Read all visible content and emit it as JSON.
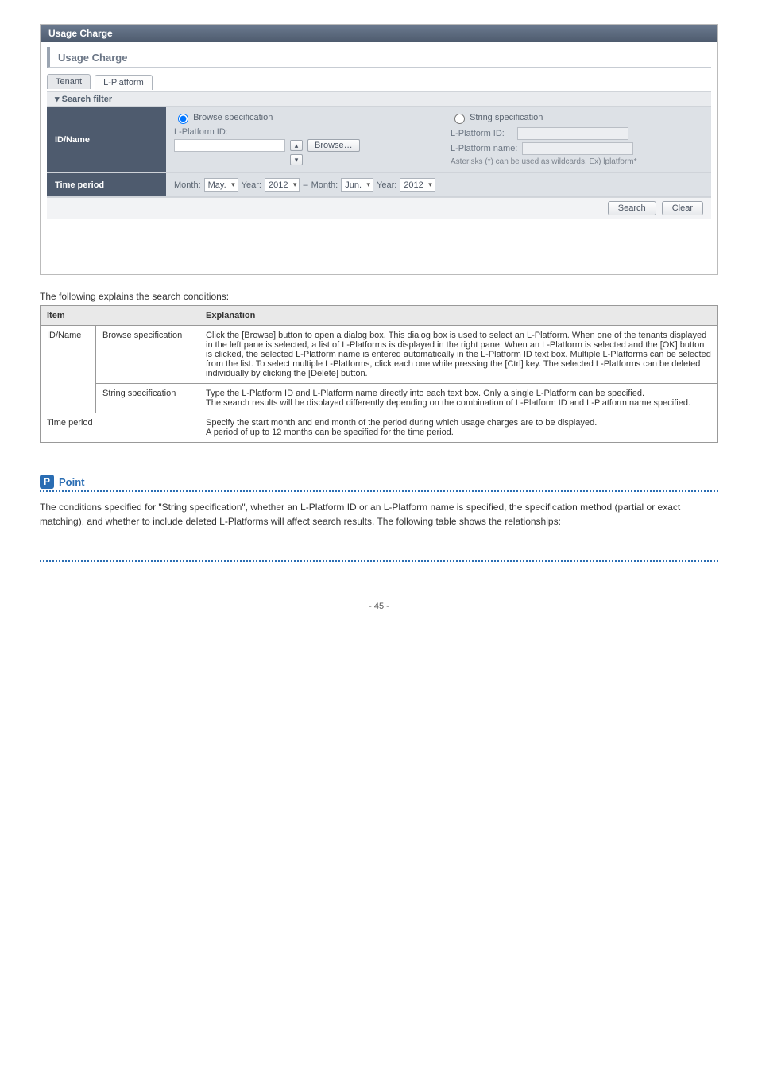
{
  "panel": {
    "title": "Usage Charge",
    "subtitle": "Usage Charge",
    "tabs": {
      "tenant": "Tenant",
      "lplatform": "L-Platform"
    },
    "filter_header": "▾ Search filter",
    "idname": {
      "label": "ID/Name",
      "browse": {
        "title": "Browse specification",
        "lplatform_id_label": "L-Platform ID:",
        "browse_btn": "Browse…"
      },
      "string": {
        "title": "String specification",
        "lplatform_id_label": "L-Platform ID:",
        "lplatform_name_label": "L-Platform name:",
        "hint": "Asterisks (*) can be used as wildcards. Ex) lplatform*"
      }
    },
    "timeperiod": {
      "label": "Time period",
      "month_label": "Month:",
      "year_label": "Year:",
      "from_month": "May.",
      "from_year": "2012",
      "dash": "–",
      "to_month": "Jun.",
      "to_year": "2012"
    },
    "buttons": {
      "search": "Search",
      "clear": "Clear"
    }
  },
  "desc_text": "The following explains the search conditions:",
  "table": {
    "headers": {
      "item": "Item",
      "explanation": "Explanation"
    },
    "rows": [
      {
        "item_main": "ID/Name",
        "item_sub": "Browse specification",
        "explanation": "Click the [Browse] button to open a dialog box. This dialog box is used to select an L-Platform. When one of the tenants displayed in the left pane is selected, a list of L-Platforms is displayed in the right pane. When an L-Platform is selected and the [OK] button is clicked, the selected L-Platform name is entered automatically in the L-Platform ID text box. Multiple L-Platforms can be selected from the list. To select multiple L-Platforms, click each one while pressing the [Ctrl] key. The selected L-Platforms can be deleted individually by clicking the [Delete] button."
      },
      {
        "item_main": "",
        "item_sub": "String specification",
        "explanation": "Type the L-Platform ID and L-Platform name directly into each text box. Only a single L-Platform can be specified.\nThe search results will be displayed differently depending on the combination of L-Platform ID and L-Platform name specified."
      },
      {
        "item_main": "Time period",
        "item_sub": "",
        "explanation": "Specify the start month and end month of the period during which usage charges are to be displayed.\nA period of up to 12 months can be specified for the time period."
      }
    ]
  },
  "point": {
    "label": "Point",
    "body": "The conditions specified for \"String specification\", whether an L-Platform ID or an L-Platform name is specified, the specification method (partial or exact matching), and whether to include deleted L-Platforms will affect search results. The following table shows the relationships:"
  },
  "pagenum": "- 45 -"
}
